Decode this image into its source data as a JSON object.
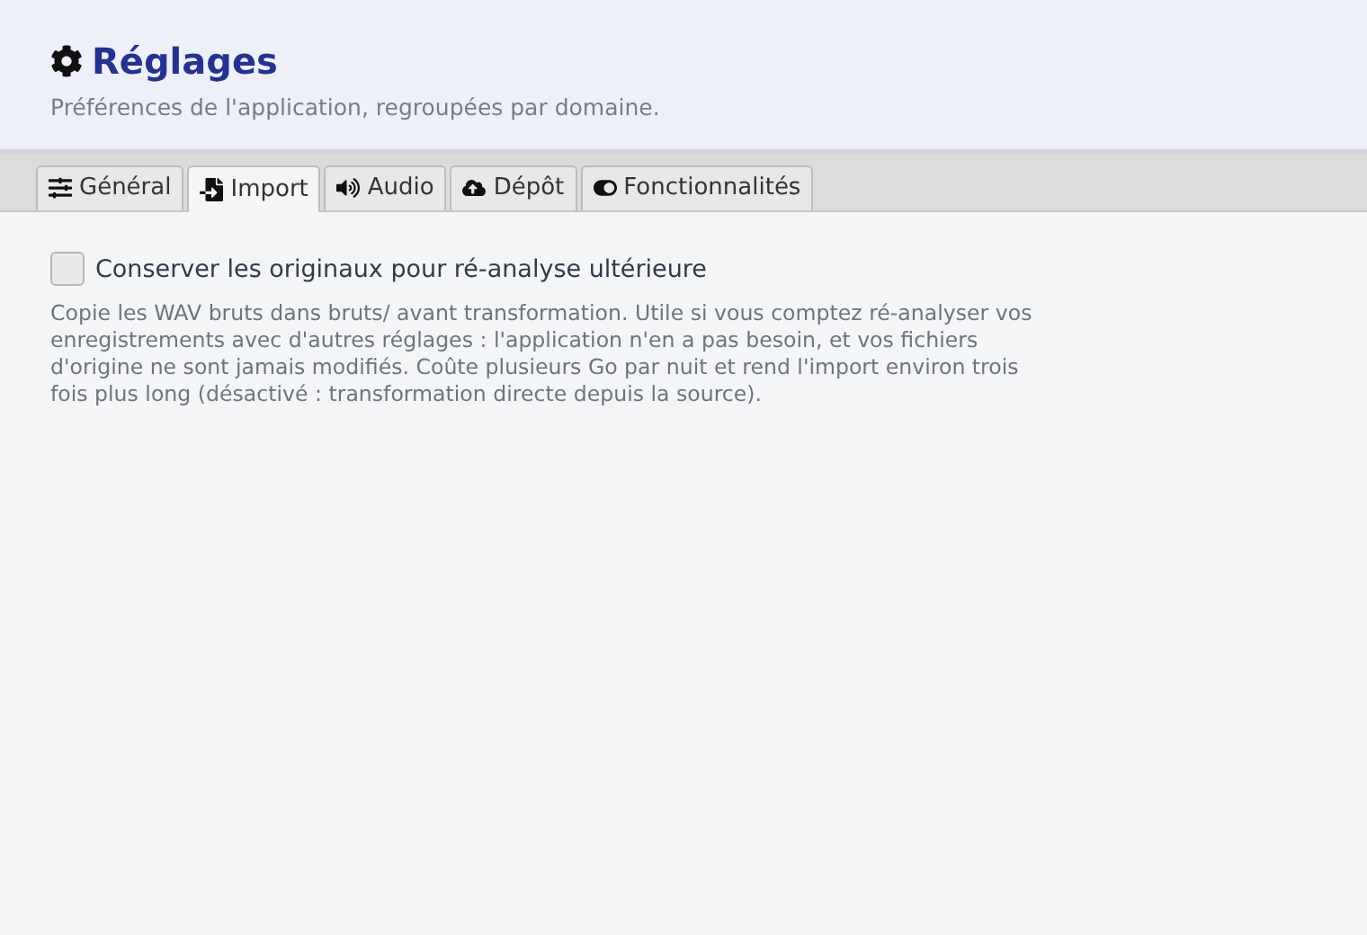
{
  "header": {
    "title": "Réglages",
    "subtitle": "Préférences de l'application, regroupées par domaine."
  },
  "tabs": [
    {
      "label": "Général",
      "selected": false
    },
    {
      "label": "Import",
      "selected": true
    },
    {
      "label": "Audio",
      "selected": false
    },
    {
      "label": "Dépôt",
      "selected": false
    },
    {
      "label": "Fonctionnalités",
      "selected": false
    }
  ],
  "options": [
    {
      "label": "Conserver les originaux pour ré-analyse ultérieure",
      "checked": false,
      "description": "Copie les WAV bruts dans bruts/ avant transformation. Utile si vous comptez ré-analyser vos enregistrements avec d'autres réglages : l'application n'en a pas besoin, et vos fichiers d'origine ne sont jamais modifiés. Coûte plusieurs Go par nuit et rend l'import environ trois fois plus long (désactivé : transformation directe depuis la source)."
    }
  ]
}
